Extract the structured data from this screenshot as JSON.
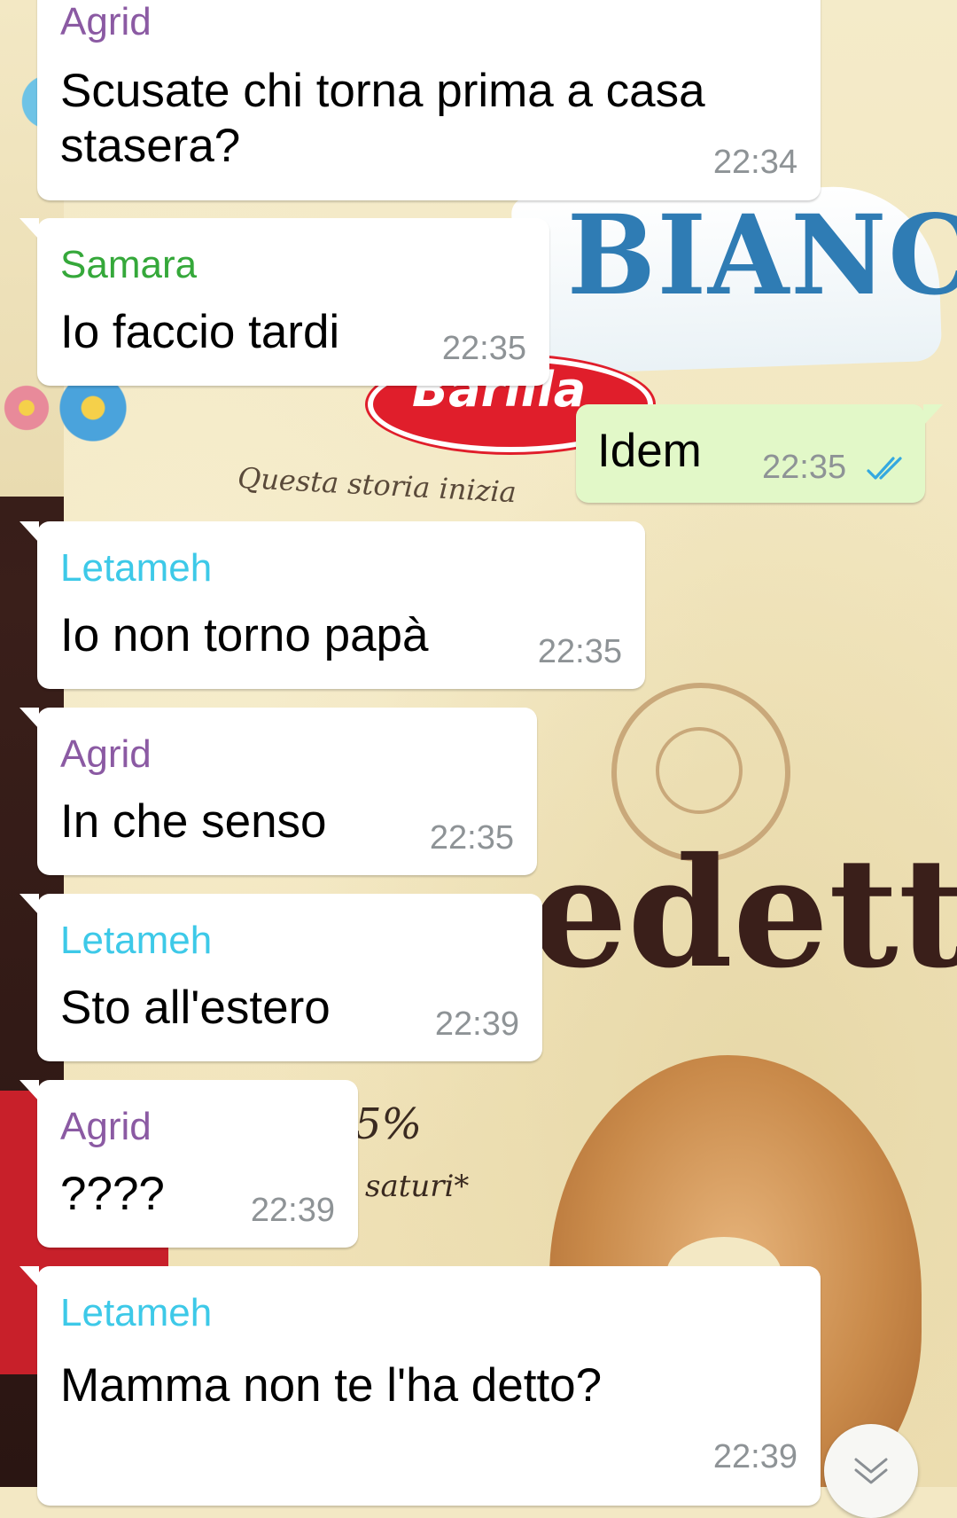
{
  "colors": {
    "incoming_bubble": "#ffffff",
    "outgoing_bubble": "#e2f8c8",
    "timestamp": "#8e9396",
    "read_check": "#34a8e0",
    "sender_agrid": "#8b5aa3",
    "sender_samara": "#35a83a",
    "sender_letameh": "#3dc9e8"
  },
  "wallpaper": {
    "brand_text": "BIANCO",
    "logo_text": "Barilla",
    "tagline": "Questa storia inizia",
    "product_text": "edetti",
    "percent_text": "5%",
    "saturi_text": "saturi*"
  },
  "messages": [
    {
      "direction": "incoming",
      "sender": "Agrid",
      "sender_color": "#8b5aa3",
      "lines": [
        "Scusate chi torna prima a casa",
        "stasera?"
      ],
      "time": "22:34"
    },
    {
      "direction": "incoming",
      "sender": "Samara",
      "sender_color": "#35a83a",
      "lines": [
        "Io faccio tardi"
      ],
      "time": "22:35"
    },
    {
      "direction": "outgoing",
      "lines": [
        "Idem"
      ],
      "time": "22:35",
      "status_icon": "double-check-read-icon"
    },
    {
      "direction": "incoming",
      "sender": "Letameh",
      "sender_color": "#3dc9e8",
      "lines": [
        "Io non torno papà"
      ],
      "time": "22:35"
    },
    {
      "direction": "incoming",
      "sender": "Agrid",
      "sender_color": "#8b5aa3",
      "lines": [
        "In che senso"
      ],
      "time": "22:35"
    },
    {
      "direction": "incoming",
      "sender": "Letameh",
      "sender_color": "#3dc9e8",
      "lines": [
        "Sto all'estero"
      ],
      "time": "22:39"
    },
    {
      "direction": "incoming",
      "sender": "Agrid",
      "sender_color": "#8b5aa3",
      "lines": [
        "????"
      ],
      "time": "22:39"
    },
    {
      "direction": "incoming",
      "sender": "Letameh",
      "sender_color": "#3dc9e8",
      "lines": [
        "Mamma non te l'ha detto?"
      ],
      "time": "22:39"
    }
  ],
  "scroll_button": {
    "icon": "double-chevron-down-icon"
  }
}
